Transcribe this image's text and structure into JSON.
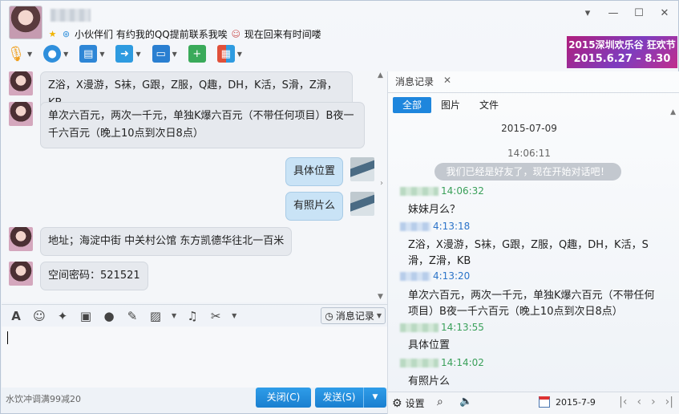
{
  "window": {
    "signature": "小伙伴们 有约我的QQ提前联系我唉",
    "signature_after": "现在回来有时间喽",
    "controls": [
      "▾",
      "—",
      "☐",
      "✕"
    ]
  },
  "toolbar": {
    "items": [
      {
        "name": "voice-call",
        "icon": "microphone-icon",
        "color": "#f0a020"
      },
      {
        "name": "video-call",
        "icon": "camera-icon",
        "color": "#2f8fdc"
      },
      {
        "name": "remote-desktop",
        "icon": "monitor-icon",
        "color": "#2e86d6"
      },
      {
        "name": "send-file",
        "icon": "folder-icon",
        "color": "#2e9be0"
      },
      {
        "name": "share-screen",
        "icon": "screen-share-icon",
        "color": "#2a7fd1"
      },
      {
        "name": "create-discussion",
        "icon": "add-chat-icon",
        "color": "#3aaa5a"
      },
      {
        "name": "apps",
        "icon": "apps-grid-icon",
        "color": "#e0503a"
      }
    ]
  },
  "banner": {
    "line1": "2015深圳欢乐谷 狂欢节",
    "line2": "2015.6.27 – 8.30"
  },
  "chat": {
    "messages": [
      {
        "side": "left",
        "text": "Z浴，X漫游，S袜，G跟，Z服，Q趣，DH，K活，S滑，Z滑，KB"
      },
      {
        "side": "left",
        "text": "单次六百元，两次一千元，单独K爆六百元（不带任何项目）B夜一千六百元（晚上10点到次日8点）"
      },
      {
        "side": "right",
        "text": "具体位置"
      },
      {
        "side": "right",
        "text": "有照片么"
      },
      {
        "side": "left",
        "text": "地址；海淀中街 中关村公馆 东方凯德华往北一百米"
      },
      {
        "side": "left",
        "text": "空间密码：521521"
      }
    ]
  },
  "input_toolbar": {
    "history_button": "消息记录"
  },
  "footer": {
    "left_text": "水饮冲调满99减20",
    "close_button": "关闭(C)",
    "send_button": "发送(S)"
  },
  "history": {
    "tab_label": "消息记录",
    "filters": [
      "全部",
      "图片",
      "文件"
    ],
    "active_filter": "全部",
    "date": "2015-07-09",
    "first_time": "14:06:11",
    "system_msg": "我们已经是好友了，现在开始对话吧！",
    "entries": [
      {
        "ts": "14:06:32",
        "color": "green",
        "text": "妹妹月么？"
      },
      {
        "ts": "4:13:18",
        "color": "blue",
        "text": "Z浴，X漫游，S袜，G跟，Z服，Q趣，DH，K活，S滑，Z滑，KB"
      },
      {
        "ts": "4:13:20",
        "color": "blue",
        "text": "单次六百元，两次一千元，单独K爆六百元（不带任何项目）B夜一千六百元（晚上10点到次日8点）"
      },
      {
        "ts": "14:13:55",
        "color": "green",
        "text": "具体位置"
      },
      {
        "ts": "14:14:02",
        "color": "green",
        "text": "有照片么"
      }
    ],
    "footer": {
      "settings_label": "设置",
      "date": "2015-7-9"
    }
  }
}
